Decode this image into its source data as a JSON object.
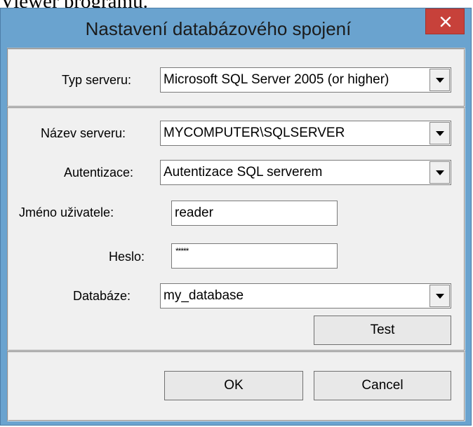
{
  "background_text": "Viewer programu.",
  "window": {
    "title": "Nastavení databázového spojení"
  },
  "server_type": {
    "label": "Typ serveru:",
    "value": "Microsoft SQL Server 2005 (or higher)"
  },
  "server_name": {
    "label": "Název serveru:",
    "value": "MYCOMPUTER\\SQLSERVER"
  },
  "authentication": {
    "label": "Autentizace:",
    "value": "Autentizace SQL serverem"
  },
  "username": {
    "label": "Jméno uživatele:",
    "value": "reader"
  },
  "password": {
    "label": "Heslo:",
    "value": "*****"
  },
  "database": {
    "label": "Databáze:",
    "value": "my_database"
  },
  "buttons": {
    "test": "Test",
    "ok": "OK",
    "cancel": "Cancel"
  },
  "colors": {
    "title_bar": "#6aa3cf",
    "close_button": "#c7413a",
    "dialog_background": "#f0f0f0"
  },
  "icons": {
    "close": "close-x-icon",
    "dropdown": "chevron-down-icon"
  }
}
